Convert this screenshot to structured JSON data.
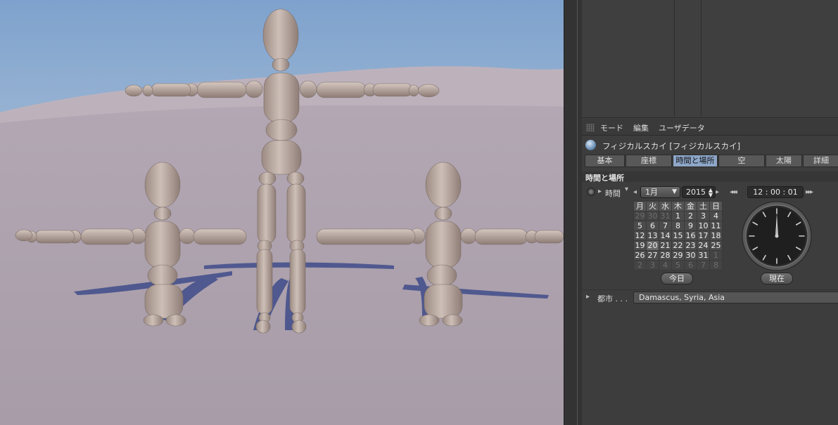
{
  "menubar": {
    "items": [
      "モード",
      "編集",
      "ユーザデータ"
    ]
  },
  "object": {
    "title": "フィジカルスカイ [フィジカルスカイ]"
  },
  "tabs": [
    "基本",
    "座標",
    "時間と場所",
    "空",
    "太陽",
    "詳細"
  ],
  "active_tab": "時間と場所",
  "section": {
    "title": "時間と場所"
  },
  "time": {
    "label": "時間",
    "month": "1月",
    "year": "2015",
    "clock_text": "12 : 00 : 01",
    "now_label": "現在"
  },
  "calendar": {
    "weekdays": [
      "月",
      "火",
      "水",
      "木",
      "金",
      "土",
      "日"
    ],
    "weeks": [
      [
        "29",
        "30",
        "31",
        "1",
        "2",
        "3",
        "4"
      ],
      [
        "5",
        "6",
        "7",
        "8",
        "9",
        "10",
        "11"
      ],
      [
        "12",
        "13",
        "14",
        "15",
        "16",
        "17",
        "18"
      ],
      [
        "19",
        "20",
        "21",
        "22",
        "23",
        "24",
        "25"
      ],
      [
        "26",
        "27",
        "28",
        "29",
        "30",
        "31",
        "1"
      ],
      [
        "2",
        "3",
        "4",
        "5",
        "6",
        "7",
        "8"
      ]
    ],
    "today_label": "今日",
    "selected_day": "20"
  },
  "city": {
    "label": "都市 . . .",
    "value": "Damascus, Syria, Asia"
  },
  "colors": {
    "accent_tab": "#8ea7c9",
    "panel_bg": "#3d3d3d"
  }
}
